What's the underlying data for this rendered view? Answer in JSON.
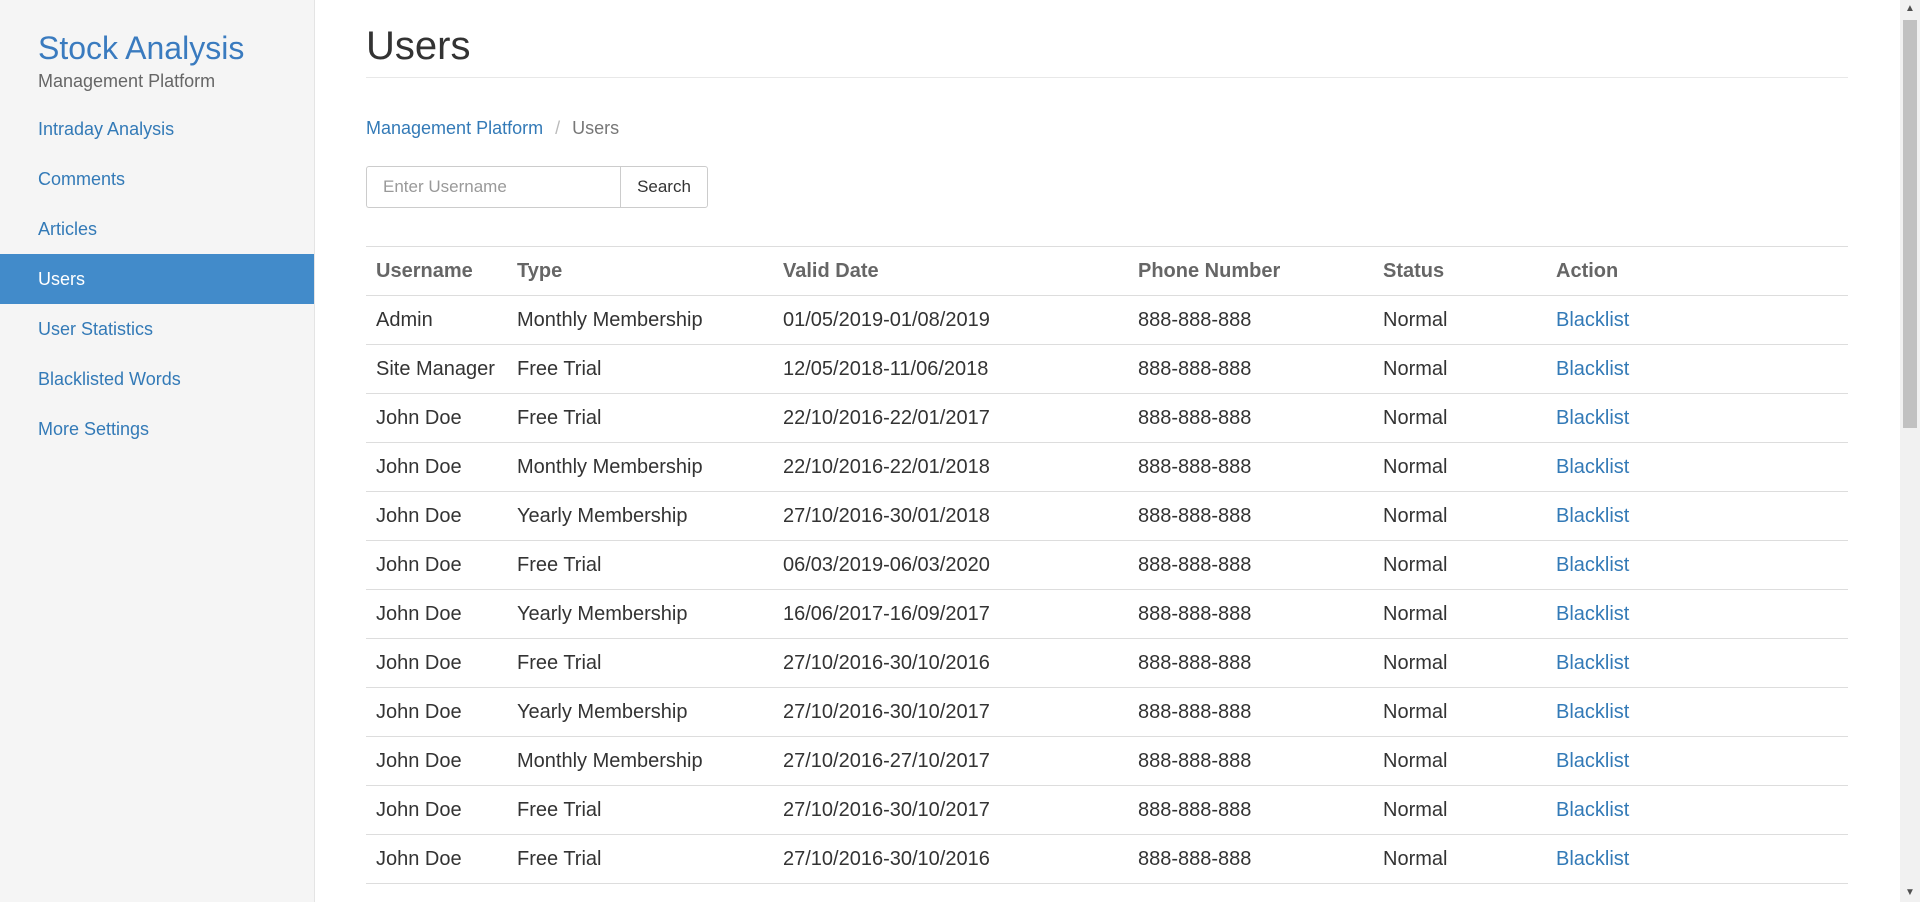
{
  "sidebar": {
    "brand_title": "Stock Analysis",
    "brand_subtitle": "Management Platform",
    "items": [
      {
        "label": "Intraday Analysis"
      },
      {
        "label": "Comments"
      },
      {
        "label": "Articles"
      },
      {
        "label": "Users"
      },
      {
        "label": "User Statistics"
      },
      {
        "label": "Blacklisted Words"
      },
      {
        "label": "More Settings"
      }
    ],
    "active_item": "Users"
  },
  "main": {
    "title": "Users",
    "breadcrumb": {
      "parent": "Management Platform",
      "separator": "/",
      "current": "Users"
    },
    "search": {
      "placeholder": "Enter Username",
      "value": "",
      "button_label": "Search"
    },
    "table": {
      "headers": [
        "Username",
        "Type",
        "Valid Date",
        "Phone Number",
        "Status",
        "Action"
      ],
      "rows": [
        {
          "username": "Admin",
          "type": "Monthly Membership",
          "valid_date": "01/05/2019-01/08/2019",
          "phone": "888-888-888",
          "status": "Normal",
          "action": "Blacklist"
        },
        {
          "username": "Site Manager",
          "type": "Free Trial",
          "valid_date": "12/05/2018-11/06/2018",
          "phone": "888-888-888",
          "status": "Normal",
          "action": "Blacklist"
        },
        {
          "username": "John Doe",
          "type": "Free Trial",
          "valid_date": "22/10/2016-22/01/2017",
          "phone": "888-888-888",
          "status": "Normal",
          "action": "Blacklist"
        },
        {
          "username": "John Doe",
          "type": "Monthly Membership",
          "valid_date": "22/10/2016-22/01/2018",
          "phone": "888-888-888",
          "status": "Normal",
          "action": "Blacklist"
        },
        {
          "username": "John Doe",
          "type": "Yearly Membership",
          "valid_date": "27/10/2016-30/01/2018",
          "phone": "888-888-888",
          "status": "Normal",
          "action": "Blacklist"
        },
        {
          "username": "John Doe",
          "type": "Free Trial",
          "valid_date": "06/03/2019-06/03/2020",
          "phone": "888-888-888",
          "status": "Normal",
          "action": "Blacklist"
        },
        {
          "username": "John Doe",
          "type": "Yearly Membership",
          "valid_date": "16/06/2017-16/09/2017",
          "phone": "888-888-888",
          "status": "Normal",
          "action": "Blacklist"
        },
        {
          "username": "John Doe",
          "type": "Free Trial",
          "valid_date": "27/10/2016-30/10/2016",
          "phone": "888-888-888",
          "status": "Normal",
          "action": "Blacklist"
        },
        {
          "username": "John Doe",
          "type": "Yearly Membership",
          "valid_date": "27/10/2016-30/10/2017",
          "phone": "888-888-888",
          "status": "Normal",
          "action": "Blacklist"
        },
        {
          "username": "John Doe",
          "type": "Monthly Membership",
          "valid_date": "27/10/2016-27/10/2017",
          "phone": "888-888-888",
          "status": "Normal",
          "action": "Blacklist"
        },
        {
          "username": "John Doe",
          "type": "Free Trial",
          "valid_date": "27/10/2016-30/10/2017",
          "phone": "888-888-888",
          "status": "Normal",
          "action": "Blacklist"
        },
        {
          "username": "John Doe",
          "type": "Free Trial",
          "valid_date": "27/10/2016-30/10/2016",
          "phone": "888-888-888",
          "status": "Normal",
          "action": "Blacklist"
        }
      ]
    }
  },
  "colors": {
    "accent": "#337ab7",
    "active_nav_bg": "#428bca",
    "sidebar_bg": "#f5f5f5"
  },
  "icons": {
    "scroll_up": "scroll-up-arrow-icon",
    "scroll_down": "scroll-down-arrow-icon"
  }
}
